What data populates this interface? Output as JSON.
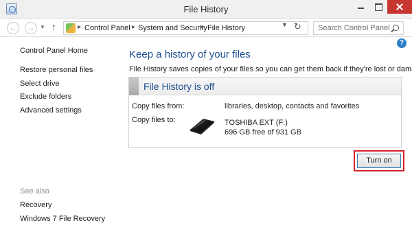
{
  "window": {
    "title": "File History",
    "controls": [
      "minimize",
      "maximize",
      "close"
    ]
  },
  "navigation": {
    "back_icon": "arrow-left-icon",
    "forward_icon": "arrow-right-icon",
    "up_icon": "arrow-up-icon",
    "breadcrumb": [
      "Control Panel",
      "System and Security",
      "File History"
    ],
    "refresh_icon": "refresh-icon",
    "search_placeholder": "Search Control Panel"
  },
  "sidebar": {
    "home": "Control Panel Home",
    "items": [
      "Restore personal files",
      "Select drive",
      "Exclude folders",
      "Advanced settings"
    ],
    "see_also_label": "See also",
    "see_also": [
      "Recovery",
      "Windows 7 File Recovery"
    ]
  },
  "main": {
    "title": "Keep a history of your files",
    "description": "File History saves copies of your files so you can get them back if they're lost or damaged.",
    "status_title": "File History is off",
    "copy_from_label": "Copy files from:",
    "copy_from_value": "libraries, desktop, contacts and favorites",
    "copy_to_label": "Copy files to:",
    "drive_name": "TOSHIBA EXT (F:)",
    "drive_space": "696 GB free of 931 GB",
    "turn_on_label": "Turn on"
  },
  "colors": {
    "heading": "#1e4e90",
    "highlight": "#d6212b",
    "close_button": "#c7372f",
    "help": "#2e7ec6"
  }
}
